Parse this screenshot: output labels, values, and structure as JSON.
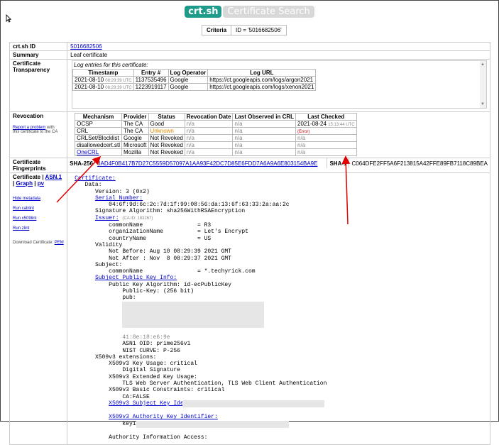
{
  "header": {
    "logo": "crt.sh",
    "title": "Certificate Search"
  },
  "criteria": {
    "label": "Criteria",
    "value": "ID = '5016682506'"
  },
  "rows": {
    "id": {
      "label": "crt.sh ID",
      "value": "5016682506"
    },
    "summary": {
      "label": "Summary",
      "value": "Leaf certificate"
    },
    "ct": {
      "label": "Certificate Transparency"
    },
    "revocation": {
      "label": "Revocation",
      "report_link": "Report a problem",
      "report_text_1": "with",
      "report_text_2": "this certificate to the CA"
    },
    "fingerprints": {
      "label": "Certificate Fingerprints"
    },
    "certificate": {
      "label": "Certificate",
      "asn1": "ASN.1",
      "graph": "Graph",
      "pv": "pv",
      "sep": "|"
    }
  },
  "ct_log": {
    "note": "Log entries for this certificate:",
    "headers": [
      "Timestamp",
      "Entry #",
      "Log Operator",
      "Log URL"
    ],
    "entries": [
      {
        "date": "2021-08-10",
        "time": "08:29:39 UTC",
        "entry": "1137535496",
        "operator": "Google",
        "url": "https://ct.googleapis.com/logs/argon2021"
      },
      {
        "date": "2021-08-10",
        "time": "08:29:39 UTC",
        "entry": "1223919117",
        "operator": "Google",
        "url": "https://ct.googleapis.com/logs/xenon2021"
      }
    ]
  },
  "revocation_table": {
    "headers": [
      "Mechanism",
      "Provider",
      "Status",
      "Revocation Date",
      "Last Observed in CRL",
      "Last Checked"
    ],
    "error_label": "(Error)",
    "rows": [
      {
        "mechanism": "OCSP",
        "provider": "The CA",
        "status": "Good",
        "rev_date": "n/a",
        "last_observed": "n/a",
        "last_checked": "2021-08-24",
        "checked_time": "15:13:44 UTC"
      },
      {
        "mechanism": "CRL",
        "provider": "The CA",
        "status": "Unknown",
        "rev_date": "n/a",
        "last_observed": "n/a",
        "last_checked": "",
        "checked_time": ""
      },
      {
        "mechanism": "CRLSet/Blocklist",
        "provider": "Google",
        "status": "Not Revoked",
        "rev_date": "n/a",
        "last_observed": "n/a",
        "last_checked": "n/a",
        "checked_time": ""
      },
      {
        "mechanism": "disallowedcert.stl",
        "provider": "Microsoft",
        "status": "Not Revoked",
        "rev_date": "n/a",
        "last_observed": "n/a",
        "last_checked": "n/a",
        "checked_time": ""
      },
      {
        "mechanism": "OneCRL",
        "provider": "Mozilla",
        "status": "Not Revoked",
        "rev_date": "n/a",
        "last_observed": "n/a",
        "last_checked": "n/a",
        "checked_time": ""
      }
    ]
  },
  "fingerprints": {
    "sha256_label": "SHA-256",
    "sha256": "0AD4F0B417B7D27C5559D57097A1AA93F42DC7D85E6FDD7A6A9A6E803154BA9E",
    "sha1_label": "SHA-1",
    "sha1": "C064DFE2FF5A6F213815A42FFE89FB7118C89BEA"
  },
  "sidebar": {
    "hide_metadata": "Hide metadata",
    "run_cablint": "Run cablint",
    "run_x509lint": "Run x509lint",
    "run_zlint": "Run zlint",
    "download": "Download Certificate:",
    "pem": "PEM"
  },
  "cert": {
    "certificate": "Certificate:",
    "data": "Data:",
    "version": "Version: 3 (0x2)",
    "serial_label": "Serial Number:",
    "serial": "04:6f:9d:6c:2c:7d:1f:99:08:56:da:13:6f:63:33:2a:aa:2c",
    "sig_alg": "Signature Algorithm: sha256WithRSAEncryption",
    "issuer_label": "Issuer:",
    "issuer_ca": "(CA ID: 183267)",
    "issuer_cn": "commonName                = R3",
    "issuer_o": "organizationName          = Let's Encrypt",
    "issuer_c": "countryName               = US",
    "validity": "Validity",
    "not_before": "Not Before: Aug 10 08:29:39 2021 GMT",
    "not_after": "Not After : Nov  8 08:29:37 2021 GMT",
    "subject": "Subject:",
    "subject_cn": "commonName                = *.techyrick.com",
    "spki_label": "Subject Public Key Info:",
    "pk_alg": "Public Key Algorithm: id-ecPublicKey",
    "pk_bits": "Public-Key: (256 bit)",
    "pub": "pub:",
    "pub_tail": "41:8e:18:e6:9e",
    "asn1_oid": "ASN1 OID: prime256v1",
    "nist": "NIST CURVE: P-256",
    "ext": "X509v3 extensions:",
    "ku": "X509v3 Key Usage: critical",
    "ku_val": "Digital Signature",
    "eku": "X509v3 Extended Key Usage:",
    "eku_val": "TLS Web Server Authentication, TLS Web Client Authentication",
    "bc": "X509v3 Basic Constraints: critical",
    "bc_val": "CA:FALSE",
    "ski_label": "X509v3 Subject Key Identifier:",
    "aki_label": "X509v3 Authority Key Identifier:",
    "aki_prefix": "keyi",
    "aia": "Authority Information Access:"
  },
  "colors": {
    "brand": "#1e9b8a",
    "link": "#0000cc",
    "annotation": "#e00000",
    "unknown": "#e08a00"
  }
}
